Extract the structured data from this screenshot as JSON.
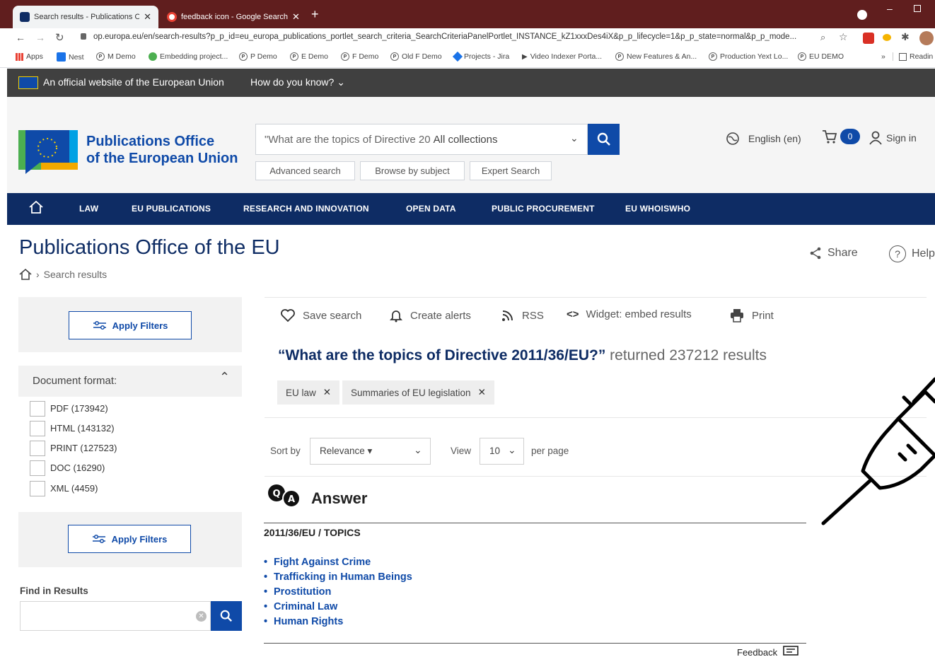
{
  "browser": {
    "tabs": [
      {
        "title": "Search results - Publications Offic",
        "active": true
      },
      {
        "title": "feedback icon - Google Search",
        "active": false
      }
    ],
    "url": "op.europa.eu/en/search-results?p_p_id=eu_europa_publications_portlet_search_criteria_SearchCriteriaPanelPortlet_INSTANCE_kZ1xxxDes4iX&p_p_lifecycle=1&p_p_state=normal&p_p_mode...",
    "bookmarks": [
      "Apps",
      "Nest",
      "M Demo",
      "Embedding project...",
      "P Demo",
      "E Demo",
      "F Demo",
      "Old F Demo",
      "Projects - Jira",
      "Video Indexer Porta...",
      "New Features & An...",
      "Production Yext Lo...",
      "EU DEMO"
    ],
    "reading_list": "Readin"
  },
  "eu_banner": {
    "official": "An official website of the European Union",
    "how": "How do you know?"
  },
  "header": {
    "logo_line1": "Publications Office",
    "logo_line2": "of the European Union",
    "search_value": "\"What are the topics of Directive 20",
    "search_scope": "All collections",
    "buttons": [
      "Advanced search",
      "Browse by subject",
      "Expert Search"
    ],
    "language": "English (en)",
    "cart_count": "0",
    "sign_in": "Sign in"
  },
  "nav": {
    "items": [
      "LAW",
      "EU PUBLICATIONS",
      "RESEARCH AND INNOVATION",
      "OPEN DATA",
      "PUBLIC PROCUREMENT",
      "EU WHOISWHO"
    ]
  },
  "page": {
    "title": "Publications Office of the EU",
    "breadcrumb": "Search results",
    "share": "Share",
    "help": "Help"
  },
  "filters": {
    "apply": "Apply Filters",
    "format_title": "Document format:",
    "formats": [
      "PDF (173942)",
      "HTML (143132)",
      "PRINT (127523)",
      "DOC (16290)",
      "XML (4459)"
    ],
    "find_label": "Find in Results"
  },
  "toolbar": {
    "save": "Save search",
    "alerts": "Create alerts",
    "rss": "RSS",
    "widget": "Widget: embed results",
    "print": "Print"
  },
  "results": {
    "query": "“What are the topics of Directive 2011/36/EU?”",
    "returned": "returned 237212 results",
    "chips": [
      "EU law",
      "Summaries of EU legislation"
    ],
    "sort_label": "Sort by",
    "sort_value": "Relevance ▾",
    "view_label": "View",
    "view_value": "10",
    "per_page": "per page"
  },
  "answer": {
    "heading": "Answer",
    "subheading": "2011/36/EU / TOPICS",
    "topics": [
      "Fight Against Crime",
      "Trafficking in Human Beings",
      "Prostitution",
      "Criminal Law",
      "Human Rights"
    ],
    "feedback": "Feedback"
  },
  "colors": {
    "brand_blue": "#0f4aa8",
    "nav_bg": "#0e2c64",
    "tabbar_bg": "#601e1e",
    "eu_bar": "#404040"
  }
}
